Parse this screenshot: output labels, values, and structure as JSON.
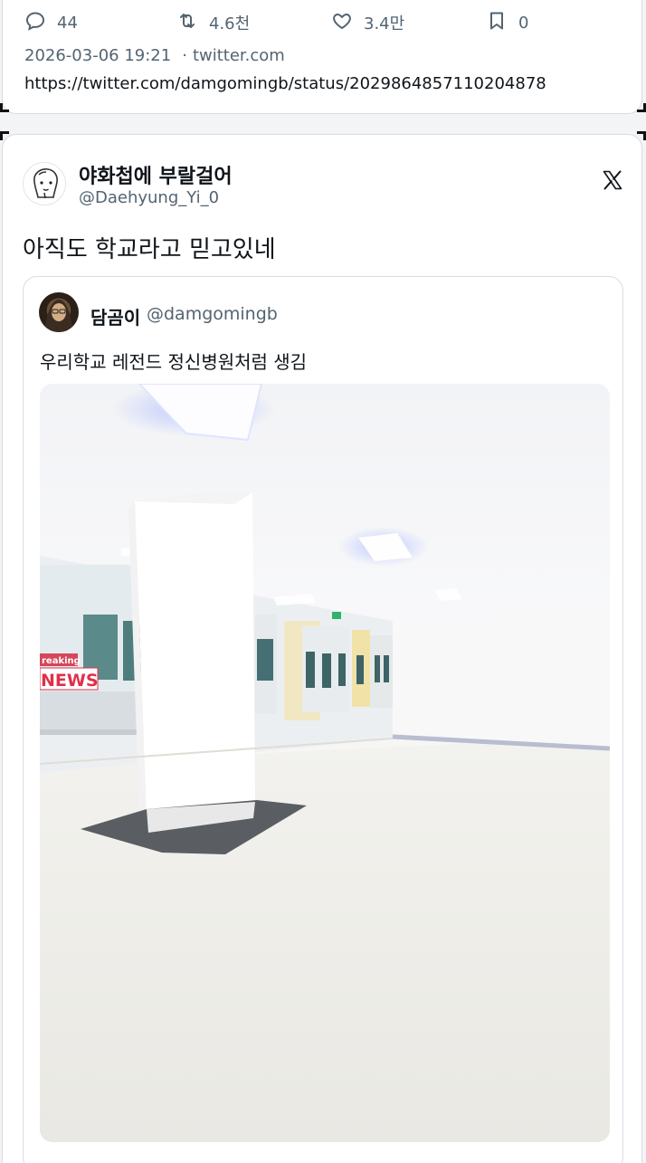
{
  "prev_tweet": {
    "replies": "44",
    "retweets": "4.6천",
    "likes": "3.4만",
    "bookmarks": "0",
    "timestamp": "2026-03-06 19:21",
    "source": "twitter.com",
    "url": "https://twitter.com/damgomingb/status/2029864857110204878"
  },
  "tweet": {
    "display_name": "야화첩에 부랄걸어",
    "handle": "@Daehyung_Yi_0",
    "text": "아직도 학교라고 믿고있네",
    "quoted": {
      "display_name": "담곰이",
      "handle": "@damgomingb",
      "text": "우리학교 레전드 정신병원처럼 생김",
      "media": {
        "badge_top": "reaking",
        "badge_bottom": "NEWS"
      }
    }
  },
  "icons": {
    "reply": "reply-icon",
    "retweet": "retweet-icon",
    "like": "heart-icon",
    "bookmark": "bookmark-icon",
    "brand": "x-logo-icon"
  },
  "colors": {
    "text": "#0f1419",
    "muted": "#536471",
    "border": "#d9dde1",
    "news_red": "#e0304a"
  }
}
